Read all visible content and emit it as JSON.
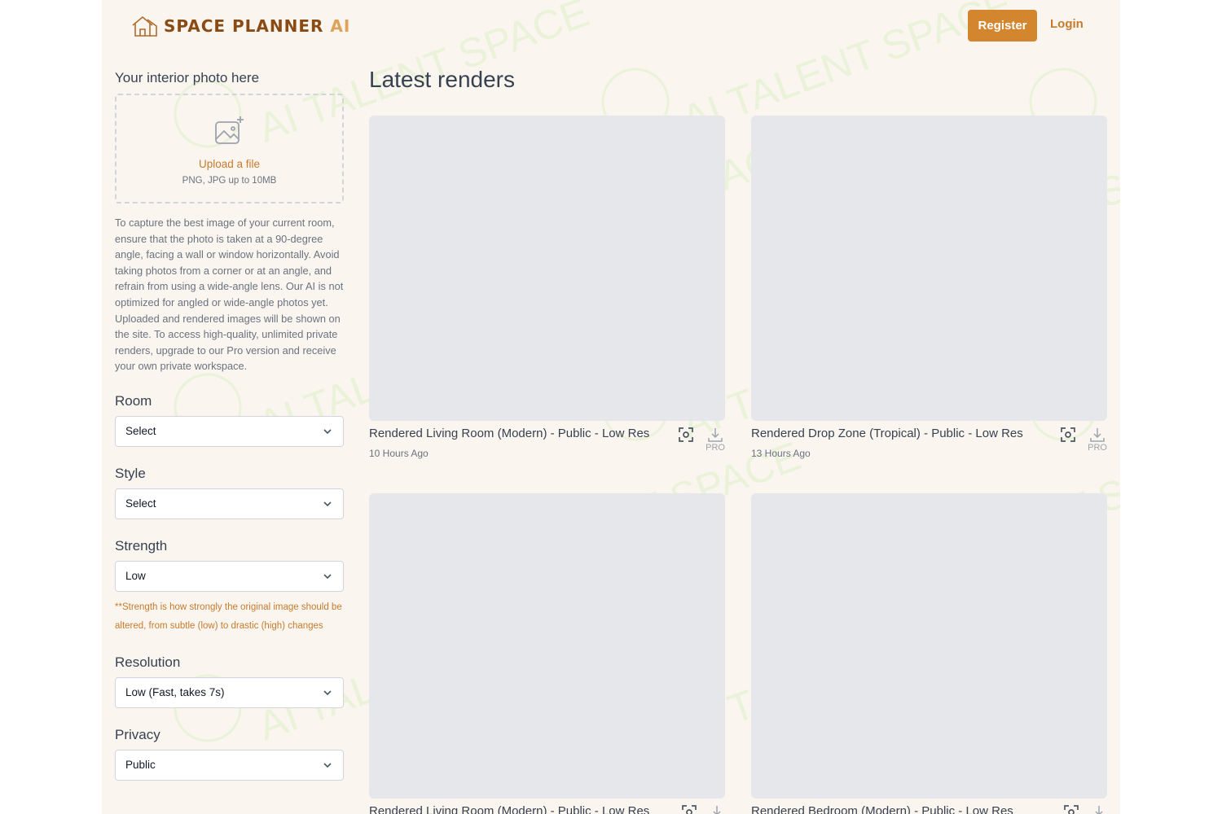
{
  "header": {
    "logo_main": "SPACE PLANNER",
    "logo_ai": "AI",
    "register_label": "Register",
    "login_label": "Login"
  },
  "sidebar": {
    "photo_heading": "Your interior photo here",
    "upload_link": "Upload a file",
    "upload_hint": "PNG, JPG up to 10MB",
    "tips": "To capture the best image of your current room, ensure that the photo is taken at a 90-degree angle, facing a wall or window horizontally. Avoid taking photos from a corner or at an angle, and refrain from using a wide-angle lens. Our AI is not optimized for angled or wide-angle photos yet. Uploaded and rendered images will be shown on the site. To access high-quality, unlimited private renders, upgrade to our Pro version and receive your own private workspace.",
    "room": {
      "label": "Room",
      "value": "Select"
    },
    "style": {
      "label": "Style",
      "value": "Select"
    },
    "strength": {
      "label": "Strength",
      "value": "Low",
      "note": "**Strength is how strongly the original image should be altered, from subtle (low) to drastic (high) changes"
    },
    "resolution": {
      "label": "Resolution",
      "value": "Low (Fast, takes 7s)"
    },
    "privacy": {
      "label": "Privacy",
      "value": "Public"
    }
  },
  "main": {
    "title": "Latest renders",
    "renders": [
      {
        "title": "Rendered Living Room (Modern) - Public - Low Res",
        "time": "10 Hours Ago",
        "pro": "PRO"
      },
      {
        "title": "Rendered Drop Zone (Tropical) - Public - Low Res",
        "time": "13 Hours Ago",
        "pro": "PRO"
      },
      {
        "title": "Rendered Living Room (Modern) - Public - Low Res",
        "time": "",
        "pro": ""
      },
      {
        "title": "Rendered Bedroom (Modern) - Public - Low Res",
        "time": "",
        "pro": ""
      }
    ]
  },
  "watermark": {
    "text": "AI TALENT SPACE"
  },
  "icons": {
    "logo": "house-icon",
    "upload": "image-plus-icon",
    "view": "focus-view-icon",
    "download": "download-icon",
    "select": "chevron-down-icon"
  },
  "colors": {
    "accent": "#d4862f",
    "link": "#c67a2c",
    "background": "#faf6ef",
    "placeholder": "#e5e7eb",
    "watermark": "#d9eec6"
  }
}
